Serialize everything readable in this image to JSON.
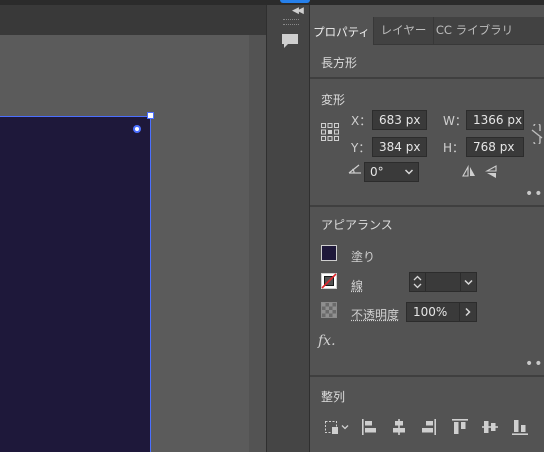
{
  "tabs": [
    {
      "label": "プロパティ",
      "active": true
    },
    {
      "label": "レイヤー",
      "active": false
    },
    {
      "label": "CC ライブラリ",
      "active": false
    }
  ],
  "selection_type": "長方形",
  "transform": {
    "title": "変形",
    "x_label": "X：",
    "x_value": "683 px",
    "y_label": "Y：",
    "y_value": "384 px",
    "w_label": "W：",
    "w_value": "1366 px",
    "h_label": "H：",
    "h_value": "768 px",
    "angle_value": "0°",
    "more": "•••"
  },
  "appearance": {
    "title": "アピアランス",
    "fill_label": "塗り",
    "stroke_label": "線",
    "opacity_label": "不透明度",
    "opacity_value": "100%",
    "fx_label": "fx.",
    "more": "•••",
    "fill_color": "#1e183a"
  },
  "align": {
    "title": "整列"
  },
  "colors": {
    "artboard": "#1e183a",
    "accent": "#2680eb",
    "selection": "#4b6fff"
  }
}
